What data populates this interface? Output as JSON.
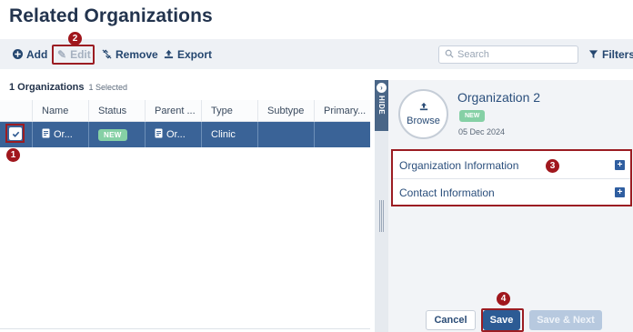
{
  "page": {
    "title": "Related Organizations"
  },
  "toolbar": {
    "add_label": "Add",
    "edit_label": "Edit",
    "remove_label": "Remove",
    "export_label": "Export",
    "search_placeholder": "Search",
    "filters_label": "Filters"
  },
  "grid": {
    "count_label": "1 Organizations",
    "selected_label": "1 Selected",
    "columns": [
      "Name",
      "Status",
      "Parent ...",
      "Type",
      "Subtype",
      "Primary..."
    ],
    "rows": [
      {
        "name": "Or...",
        "status": "NEW",
        "parent": "Or...",
        "type": "Clinic",
        "subtype": "",
        "primary": ""
      }
    ]
  },
  "side_panel": {
    "hide_label": "HIDE",
    "browse_label": "Browse",
    "org_name": "Organization 2",
    "org_status": "NEW",
    "org_date": "05 Dec 2024",
    "sections": [
      "Organization Information",
      "Contact Information"
    ],
    "cancel_label": "Cancel",
    "save_label": "Save",
    "save_next_label": "Save & Next"
  },
  "callouts": [
    "1",
    "2",
    "3",
    "4"
  ],
  "colors": {
    "primary": "#2c5b94",
    "selected_row": "#3a6397",
    "callout": "#a0171d",
    "new_badge": "#85d0a5"
  }
}
